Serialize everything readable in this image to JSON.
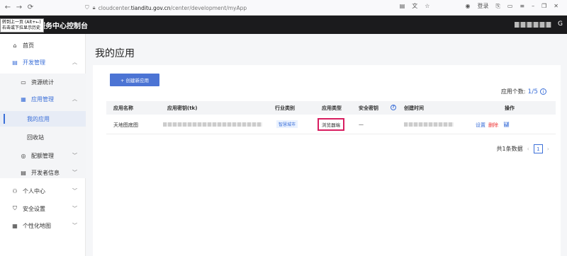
{
  "browser": {
    "url_prefix": "cloudcenter.",
    "url_domain": "tianditu.gov.cn",
    "url_path": "/center/development/myApp",
    "login_label": "登录"
  },
  "tooltip": {
    "line1": "转到上一页 (Alt+←)",
    "line2": "右击或下拉显示历史"
  },
  "topbar": {
    "title": "服务中心控制台",
    "exit_icon": "G"
  },
  "sidebar": {
    "home": "首页",
    "dev": "开发管理",
    "stats": "资源统计",
    "appmgmt": "应用管理",
    "myapps": "我的应用",
    "recycle": "回收站",
    "quota": "配额管理",
    "devinfo": "开发者信息",
    "personal": "个人中心",
    "security": "安全设置",
    "custommap": "个性化地图"
  },
  "main": {
    "title": "我的应用",
    "create_btn": "+ 创建新应用",
    "count_label": "应用个数:",
    "count_value": "1/5"
  },
  "table": {
    "headers": [
      "应用名称",
      "应用密钥(tk)",
      "行业类别",
      "应用类型",
      "安全密钥",
      "创建时间",
      "操作"
    ],
    "row": {
      "name": "天地图底图",
      "industry": "智慧城市",
      "type": "浏览器端",
      "security": "—",
      "op_set": "设置",
      "op_del": "删除"
    }
  },
  "pager": {
    "total": "共1条数据",
    "page": "1",
    "prev": "‹",
    "next": "›"
  }
}
